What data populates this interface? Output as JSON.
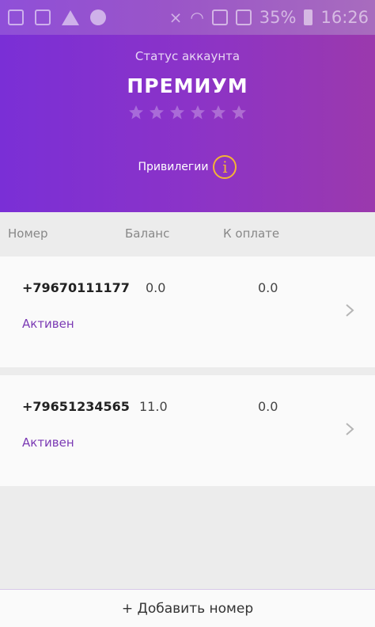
{
  "status_bar": {
    "battery_percent": "35%",
    "time": "16:26"
  },
  "header": {
    "status_label": "Статус аккаунта",
    "status_value": "ПРЕМИУМ",
    "stars_total": 6,
    "stars_filled": 0,
    "privileges_label": "Привилегии",
    "info_glyph": "i",
    "colors": {
      "gradient_start": "#7a2fd6",
      "gradient_end": "#9b39ad",
      "accent": "#f3b435"
    }
  },
  "table": {
    "columns": [
      "Номер",
      "Баланс",
      "К оплате"
    ],
    "rows": [
      {
        "number": "+79670111177",
        "balance": "0.0",
        "due": "0.0",
        "status": "Активен"
      },
      {
        "number": "+79651234565",
        "balance": "11.0",
        "due": "0.0",
        "status": "Активен"
      }
    ]
  },
  "footer": {
    "add_label": "+ Добавить номер"
  },
  "icons": [
    "notification-icon",
    "sim-icon",
    "warning-icon",
    "location-icon",
    "mute-icon",
    "wifi-icon",
    "signal-icon",
    "battery-icon",
    "star-icon",
    "info-icon",
    "chevron-right-icon"
  ]
}
